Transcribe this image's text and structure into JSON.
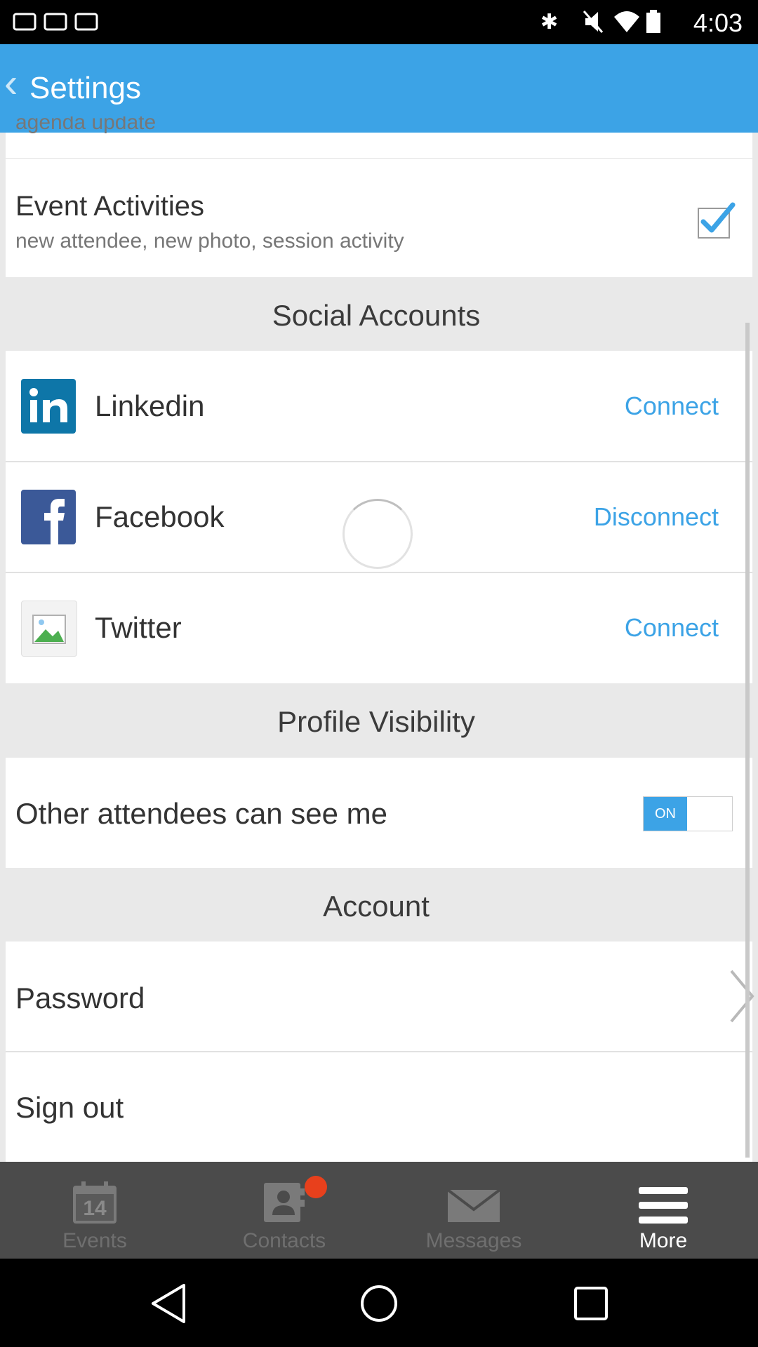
{
  "status_bar": {
    "time": "4:03"
  },
  "header": {
    "title": "Settings"
  },
  "notifications": {
    "partial_item_text": "agenda update",
    "event_activities": {
      "title": "Event Activities",
      "subtitle": "new attendee, new photo, session activity",
      "checked": true
    }
  },
  "social_accounts": {
    "section_title": "Social Accounts",
    "items": [
      {
        "name": "Linkedin",
        "action": "Connect"
      },
      {
        "name": "Facebook",
        "action": "Disconnect"
      },
      {
        "name": "Twitter",
        "action": "Connect"
      }
    ]
  },
  "profile_visibility": {
    "section_title": "Profile Visibility",
    "setting_label": "Other attendees can see me",
    "toggle_label": "ON"
  },
  "account": {
    "section_title": "Account",
    "items": [
      {
        "label": "Password"
      },
      {
        "label": "Sign out"
      }
    ]
  },
  "bottom_nav": {
    "items": [
      {
        "label": "Events",
        "icon": "calendar-icon",
        "calendar_day": "14"
      },
      {
        "label": "Contacts",
        "icon": "contacts-icon",
        "badge": true
      },
      {
        "label": "Messages",
        "icon": "envelope-icon"
      },
      {
        "label": "More",
        "icon": "menu-icon",
        "active": true
      }
    ]
  },
  "colors": {
    "accent": "#3ca3e6",
    "header": "#3ca3e6",
    "nav_bg": "#4b4b4b",
    "badge": "#e8401c",
    "linkedin": "#0e76a8",
    "facebook": "#3b5998"
  }
}
